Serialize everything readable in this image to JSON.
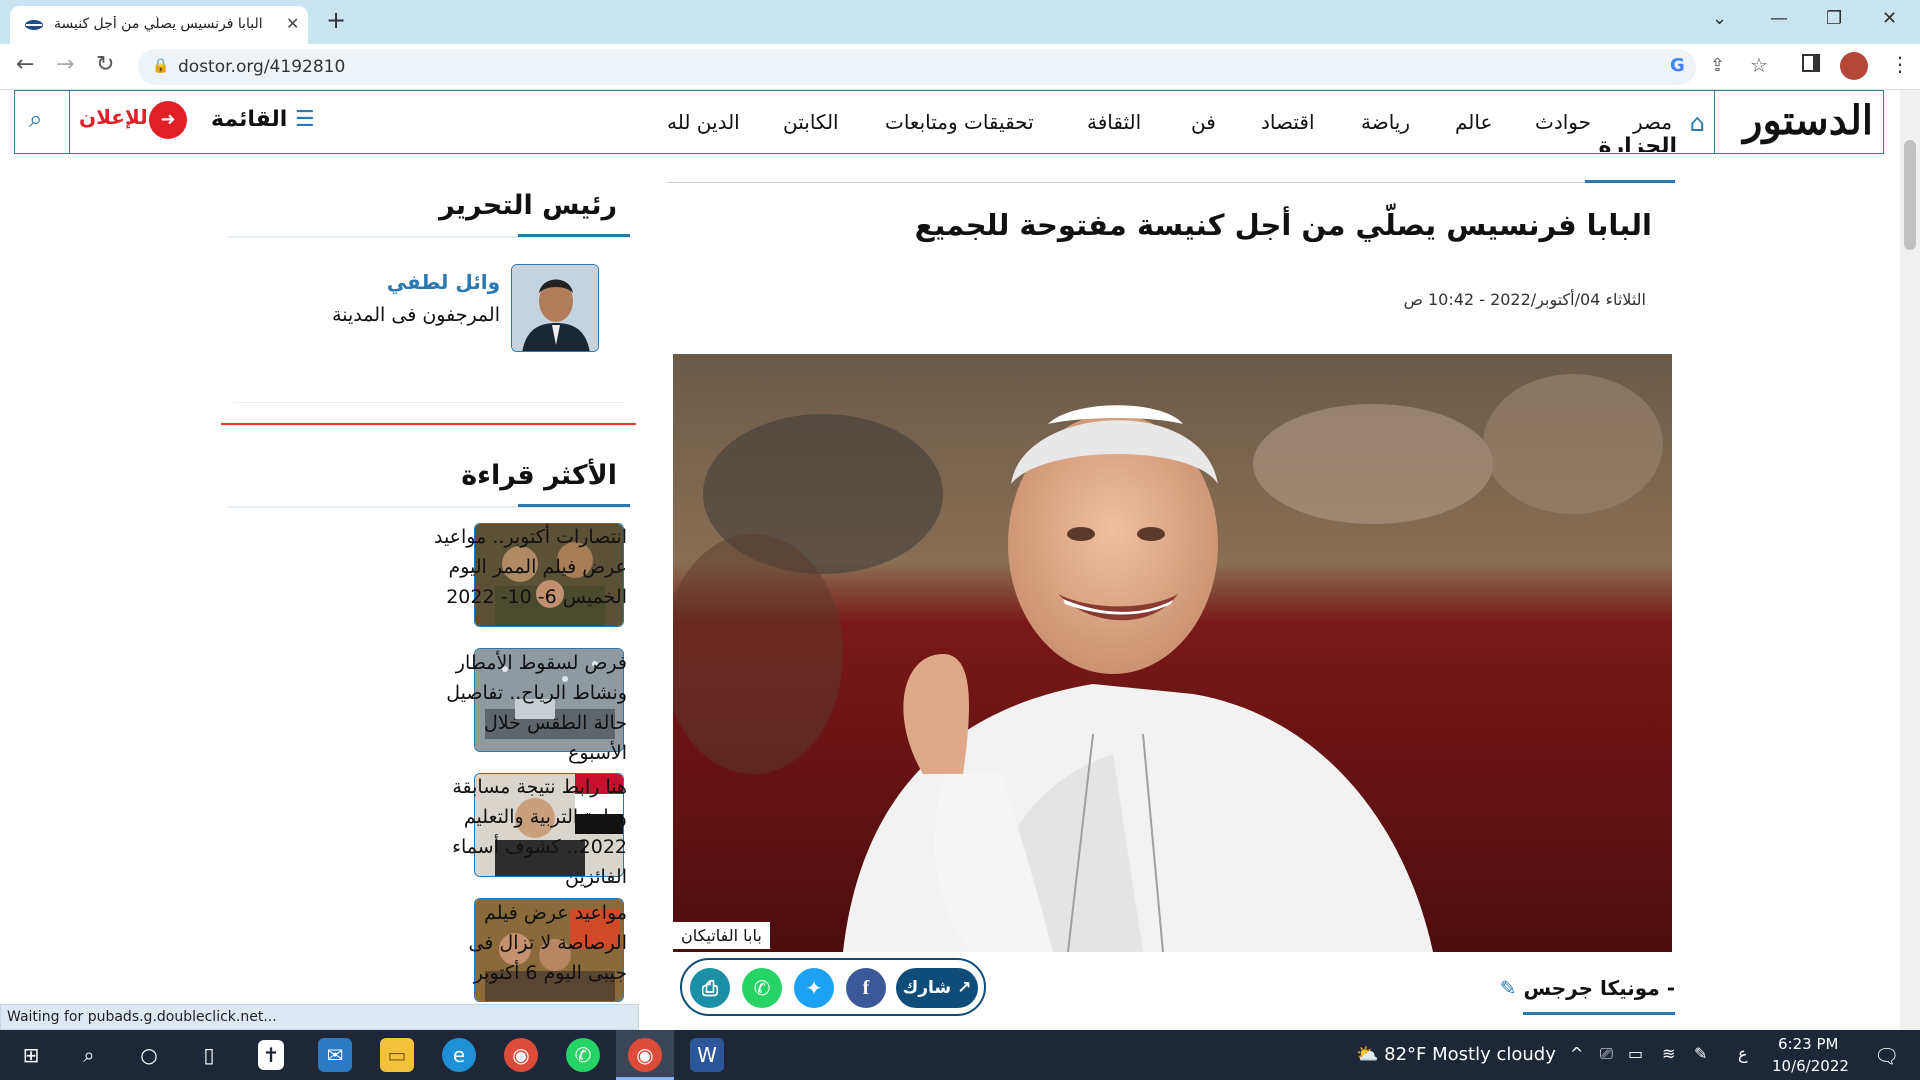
{
  "browser": {
    "tab_title": "البابا فرنسيس يصلّي من أجل كنيسة",
    "url": "dostor.org/4192810",
    "new_tab": "+",
    "tab_close": "✕"
  },
  "site": {
    "logo": "الدستور",
    "nav": [
      "مصر",
      "حوادث",
      "عالم",
      "رياضة",
      "اقتصاد",
      "فن",
      "الثقافة",
      "تحقيقات ومتابعات",
      "الكابتن",
      "الدين لله"
    ],
    "menu_label": "القائمة",
    "advertise_label": "للإعلان"
  },
  "article": {
    "section": "الحزارة",
    "headline": "البابا فرنسيس يصلّي من أجل كنيسة مفتوحة للجميع",
    "date": "الثلاثاء 04/أكتوبر/2022 - 10:42 ص",
    "photo_caption": "بابا الفاتيكان",
    "share_label": "شارك",
    "author": "- مونيكا جرجس"
  },
  "sidebar": {
    "editor_title": "رئيس التحرير",
    "editor_name": "وائل لطفي",
    "editor_article": "المرجفون فى المدينة",
    "most_read_title": "الأكثر قراءة",
    "most_read": [
      {
        "title": "انتصارات أكتوبر.. مواعيد عرض فيلم الممر اليوم الخميس 6- 10- 2022"
      },
      {
        "title": "فرص لسقوط الأمطار ونشاط الرياح.. تفاصيل حالة الطقس خلال الأسبوع"
      },
      {
        "title": "هنا رابط نتيجة مسابقة وزارة التربية والتعليم 2022.. كشوف أسماء الفائزين"
      },
      {
        "title": "مواعيد عرض فيلم الرصاصة لا تزال فى جيبى اليوم 6 أكتوبر"
      }
    ]
  },
  "status_bar": "Waiting for pubads.g.doubleclick.net...",
  "taskbar": {
    "weather": "82°F  Mostly cloudy",
    "lang": "ع",
    "time": "6:23 PM",
    "date": "10/6/2022"
  },
  "colors": {
    "accent_blue": "#2a79b3",
    "brand_red": "#e01f26",
    "share_navy": "#0e4d7a",
    "facebook": "#3b5998",
    "twitter": "#1da1f2",
    "whatsapp": "#25d366",
    "print": "#1a8fa6"
  }
}
